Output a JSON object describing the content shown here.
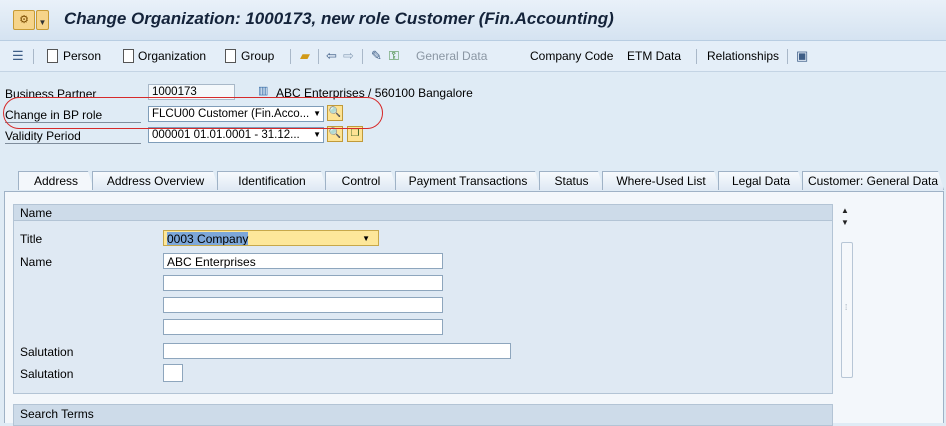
{
  "window": {
    "title": "Change Organization: 1000173, new role Customer (Fin.Accounting)",
    "menu_icon": "sap-menu-icon"
  },
  "toolbar": {
    "person": "Person",
    "organization": "Organization",
    "group": "Group",
    "general_data": "General Data",
    "company_code": "Company Code",
    "etm_data": "ETM Data",
    "relationships": "Relationships"
  },
  "header": {
    "bp_label": "Business Partner",
    "bp_value": "1000173",
    "bp_description": "ABC Enterprises / 560100 Bangalore",
    "role_label": "Change in BP role",
    "role_value": "FLCU00 Customer (Fin.Acco...",
    "validity_label": "Validity Period",
    "validity_value": "000001 01.01.0001 - 31.12..."
  },
  "tabs": [
    {
      "label": "Address",
      "active": true
    },
    {
      "label": "Address Overview",
      "active": false
    },
    {
      "label": "Identification",
      "active": false
    },
    {
      "label": "Control",
      "active": false
    },
    {
      "label": "Payment Transactions",
      "active": false
    },
    {
      "label": "Status",
      "active": false
    },
    {
      "label": "Where-Used List",
      "active": false
    },
    {
      "label": "Legal Data",
      "active": false
    },
    {
      "label": "Customer: General Data",
      "active": false
    }
  ],
  "name_section": {
    "title": "Name",
    "title_label": "Title",
    "title_value": "0003 Company",
    "name_label": "Name",
    "name_value": "ABC Enterprises",
    "name2_value": "",
    "name3_value": "",
    "name4_value": "",
    "salutation_label": "Salutation",
    "salutation_value": "",
    "salutation2_label": "Salutation",
    "salutation2_value": ""
  },
  "search_terms": {
    "title": "Search Terms"
  },
  "colors": {
    "highlight_circle": "#d62a2a",
    "background": "#dfebf5"
  }
}
